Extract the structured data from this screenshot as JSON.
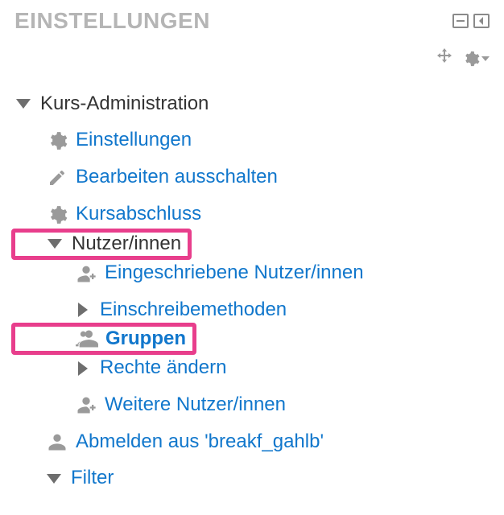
{
  "panel": {
    "title": "EINSTELLUNGEN"
  },
  "tree": {
    "root": "Kurs-Administration",
    "items": {
      "settings": "Einstellungen",
      "edit_off": "Bearbeiten ausschalten",
      "completion": "Kursabschluss",
      "users": "Nutzer/innen",
      "enrolled": "Eingeschriebene Nutzer/innen",
      "enrol_methods": "Einschreibemethoden",
      "groups": "Gruppen",
      "permissions": "Rechte ändern",
      "other_users": "Weitere Nutzer/innen",
      "unenrol": "Abmelden aus 'breakf_gahlb'",
      "filter": "Filter"
    }
  }
}
